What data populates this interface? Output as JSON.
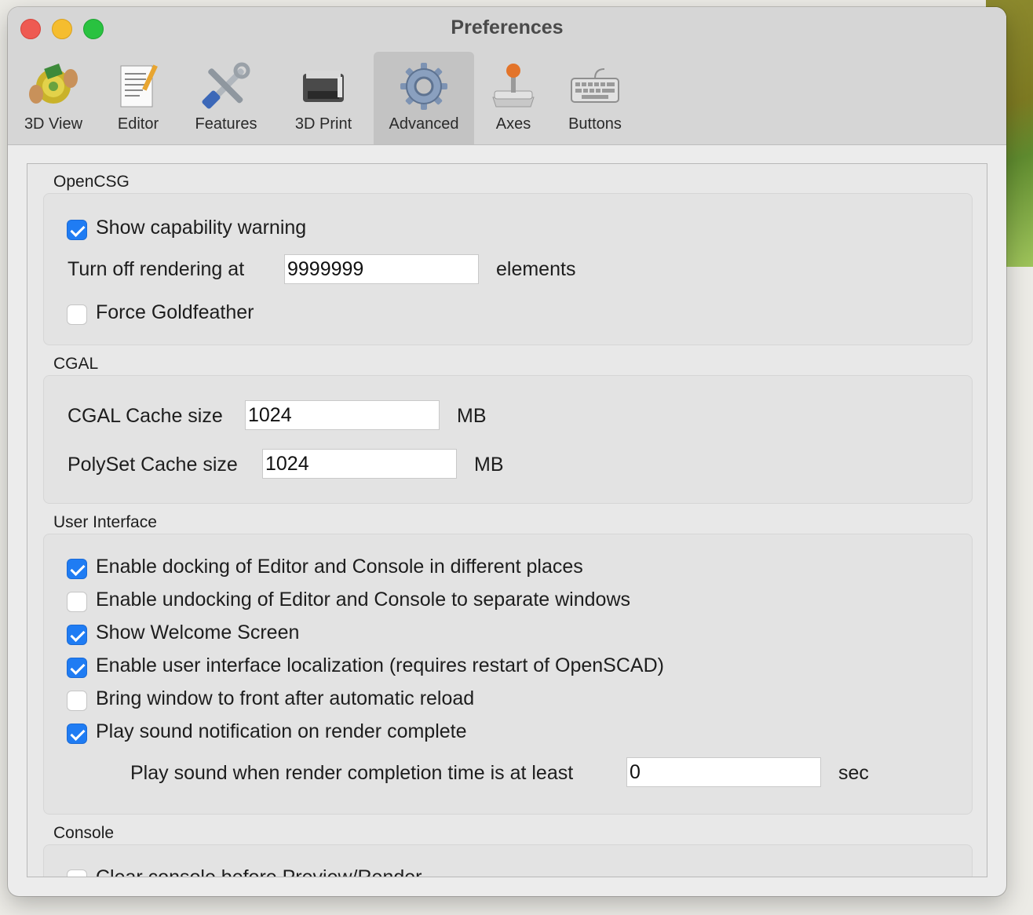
{
  "window": {
    "title": "Preferences"
  },
  "toolbar": {
    "items": [
      {
        "label": "3D View",
        "icon": "3d-view-icon"
      },
      {
        "label": "Editor",
        "icon": "editor-icon"
      },
      {
        "label": "Features",
        "icon": "features-icon"
      },
      {
        "label": "3D Print",
        "icon": "3d-print-icon"
      },
      {
        "label": "Advanced",
        "icon": "gear-icon",
        "active": true
      },
      {
        "label": "Axes",
        "icon": "joystick-icon"
      },
      {
        "label": "Buttons",
        "icon": "keyboard-icon"
      }
    ]
  },
  "opencsg": {
    "title": "OpenCSG",
    "show_capability_warning": {
      "label": "Show capability warning",
      "checked": true
    },
    "turn_off_label": "Turn off rendering at",
    "turn_off_value": "9999999",
    "turn_off_unit": "elements",
    "force_goldfeather": {
      "label": "Force Goldfeather",
      "checked": false
    }
  },
  "cgal": {
    "title": "CGAL",
    "cache_label": "CGAL Cache size",
    "cache_value": "1024",
    "cache_unit": "MB",
    "polyset_label": "PolySet Cache size",
    "polyset_value": "1024",
    "polyset_unit": "MB"
  },
  "ui": {
    "title": "User Interface",
    "options": [
      {
        "label": "Enable docking of Editor and Console in different places",
        "checked": true
      },
      {
        "label": "Enable undocking of Editor and Console to separate windows",
        "checked": false
      },
      {
        "label": "Show Welcome Screen",
        "checked": true
      },
      {
        "label": "Enable user interface localization (requires restart of OpenSCAD)",
        "checked": true
      },
      {
        "label": "Bring window to front after automatic reload",
        "checked": false
      },
      {
        "label": "Play sound notification on render complete",
        "checked": true
      }
    ],
    "sound_label": "Play sound when render completion time is at least",
    "sound_value": "0",
    "sound_unit": "sec"
  },
  "console": {
    "title": "Console",
    "clear_label": "Clear console before Preview/Render"
  },
  "colors": {
    "accent": "#1f7cf3"
  }
}
